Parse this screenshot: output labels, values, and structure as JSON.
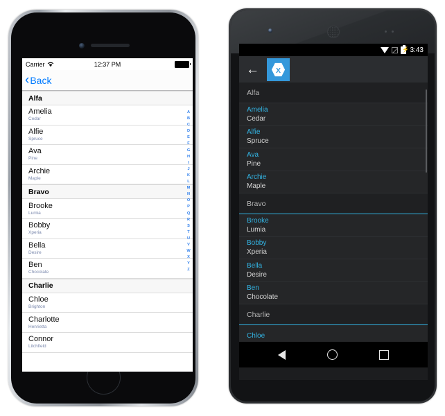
{
  "ios": {
    "status_bar": {
      "carrier": "Carrier",
      "wifi_icon": "wifi-icon",
      "time": "12:37 PM",
      "battery_icon": "battery-full-icon"
    },
    "nav_bar": {
      "back_label": "Back",
      "back_chevron": "chevron-left-icon"
    },
    "index_letters": [
      "A",
      "B",
      "C",
      "D",
      "E",
      "F",
      "G",
      "H",
      "I",
      "J",
      "K",
      "L",
      "M",
      "N",
      "O",
      "P",
      "Q",
      "R",
      "S",
      "T",
      "U",
      "V",
      "W",
      "X",
      "Y",
      "Z"
    ],
    "list": [
      {
        "type": "header",
        "title": "Alfa"
      },
      {
        "type": "row",
        "name": "Amelia",
        "detail": "Cedar"
      },
      {
        "type": "row",
        "name": "Alfie",
        "detail": "Spruce"
      },
      {
        "type": "row",
        "name": "Ava",
        "detail": "Pine"
      },
      {
        "type": "row",
        "name": "Archie",
        "detail": "Maple"
      },
      {
        "type": "header",
        "title": "Bravo"
      },
      {
        "type": "row",
        "name": "Brooke",
        "detail": "Lumia"
      },
      {
        "type": "row",
        "name": "Bobby",
        "detail": "Xperia"
      },
      {
        "type": "row",
        "name": "Bella",
        "detail": "Desire"
      },
      {
        "type": "row",
        "name": "Ben",
        "detail": "Chocolate"
      },
      {
        "type": "header",
        "title": "Charlie"
      },
      {
        "type": "row",
        "name": "Chloe",
        "detail": "Brighton"
      },
      {
        "type": "row",
        "name": "Charlotte",
        "detail": "Henrietta"
      },
      {
        "type": "row",
        "name": "Connor",
        "detail": "Litchfield"
      }
    ]
  },
  "android": {
    "status_bar": {
      "wifi_icon": "wifi-icon",
      "signal_icon": "cellular-signal-off-icon",
      "battery_icon": "battery-charging-icon",
      "time": "3:43"
    },
    "toolbar": {
      "back_arrow": "arrow-left-icon",
      "logo": "xamarin-logo-icon"
    },
    "list": [
      {
        "type": "header",
        "title": "Alfa"
      },
      {
        "type": "row",
        "name": "Amelia",
        "detail": "Cedar"
      },
      {
        "type": "row",
        "name": "Alfie",
        "detail": "Spruce"
      },
      {
        "type": "row",
        "name": "Ava",
        "detail": "Pine"
      },
      {
        "type": "row",
        "name": "Archie",
        "detail": "Maple"
      },
      {
        "type": "header",
        "title": "Bravo"
      },
      {
        "type": "row",
        "name": "Brooke",
        "detail": "Lumia"
      },
      {
        "type": "row",
        "name": "Bobby",
        "detail": "Xperia"
      },
      {
        "type": "row",
        "name": "Bella",
        "detail": "Desire"
      },
      {
        "type": "row",
        "name": "Ben",
        "detail": "Chocolate"
      },
      {
        "type": "header",
        "title": "Charlie"
      },
      {
        "type": "row",
        "name": "Chloe",
        "detail": ""
      }
    ],
    "nav_bar": {
      "back": "nav-back-icon",
      "home": "nav-home-icon",
      "recents": "nav-recents-icon"
    }
  },
  "colors": {
    "ios_accent": "#007aff",
    "android_accent": "#33b5e5",
    "xamarin_blue": "#3498db"
  }
}
